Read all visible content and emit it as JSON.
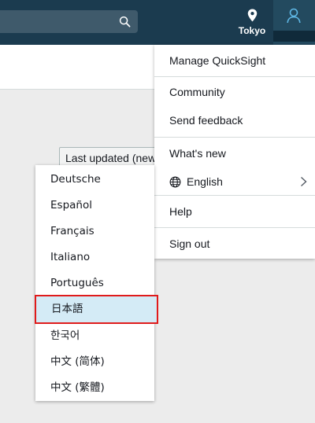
{
  "header": {
    "region_label": "Tokyo",
    "icons": {
      "search": "search-icon",
      "region": "location-pin-icon",
      "user": "user-icon"
    }
  },
  "page": {
    "sort_label": "Last updated (newest first)"
  },
  "account_menu": {
    "manage": "Manage QuickSight",
    "community": "Community",
    "feedback": "Send feedback",
    "whats_new": "What's new",
    "language": "English",
    "help": "Help",
    "sign_out": "Sign out"
  },
  "language_menu": {
    "items": [
      "Deutsche",
      "Español",
      "Français",
      "Italiano",
      "Português",
      "日本語",
      "한국어",
      "中文 (简体)",
      "中文 (繁體)"
    ],
    "selected": "日本語"
  },
  "colors": {
    "header_bg": "#1b3b4f",
    "selected_bg": "#d4ebf6",
    "highlight_outline": "#e01b1b"
  }
}
